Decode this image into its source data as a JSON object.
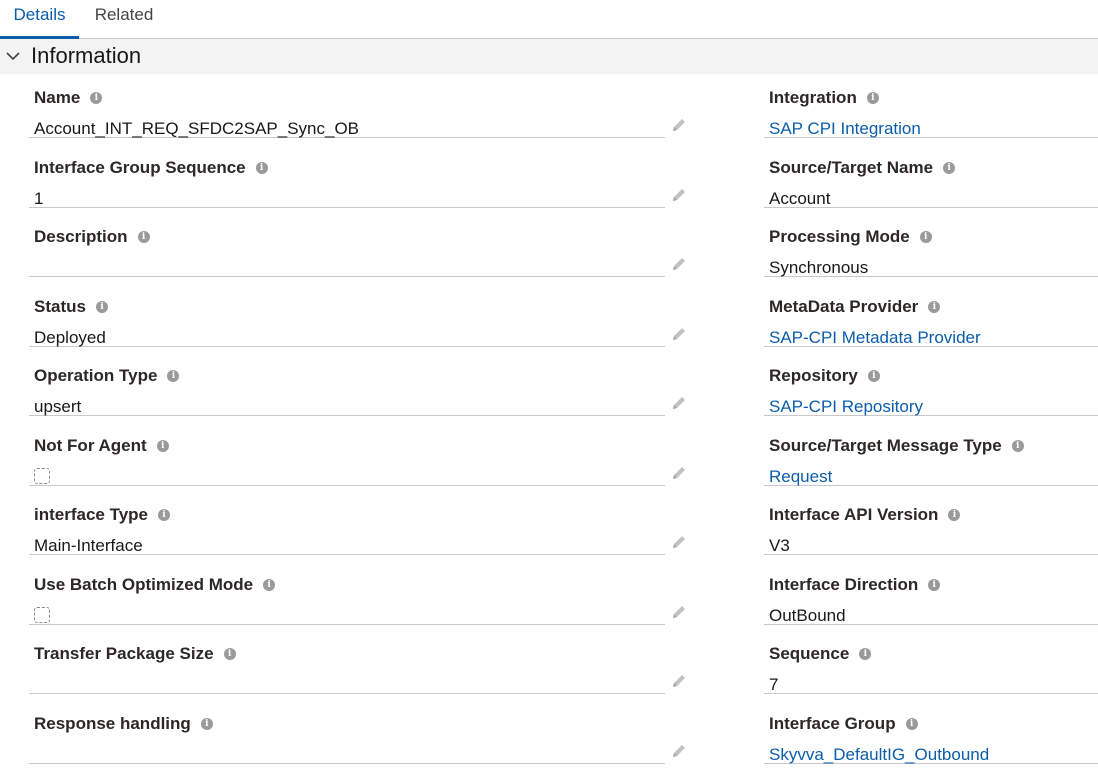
{
  "tabs": [
    {
      "label": "Details",
      "active": true
    },
    {
      "label": "Related",
      "active": false
    }
  ],
  "section": {
    "title": "Information",
    "icon": "chevron-down-icon"
  },
  "left_fields": [
    {
      "label": "Name",
      "value": "Account_INT_REQ_SFDC2SAP_Sync_OB",
      "type": "text"
    },
    {
      "label": "Interface Group Sequence",
      "value": "1",
      "type": "text"
    },
    {
      "label": "Description",
      "value": "",
      "type": "text"
    },
    {
      "label": "Status",
      "value": "Deployed",
      "type": "text"
    },
    {
      "label": "Operation Type",
      "value": "upsert",
      "type": "text"
    },
    {
      "label": "Not For Agent",
      "value": "",
      "type": "checkbox",
      "checked": false
    },
    {
      "label": "interface Type",
      "value": "Main-Interface",
      "type": "text"
    },
    {
      "label": "Use Batch Optimized Mode",
      "value": "",
      "type": "checkbox",
      "checked": false
    },
    {
      "label": "Transfer Package Size",
      "value": "",
      "type": "text"
    },
    {
      "label": "Response handling",
      "value": "",
      "type": "text"
    }
  ],
  "right_fields": [
    {
      "label": "Integration",
      "value": "SAP CPI Integration",
      "type": "link"
    },
    {
      "label": "Source/Target Name",
      "value": "Account",
      "type": "text"
    },
    {
      "label": "Processing Mode",
      "value": "Synchronous",
      "type": "text"
    },
    {
      "label": "MetaData Provider",
      "value": "SAP-CPI Metadata Provider",
      "type": "link"
    },
    {
      "label": "Repository",
      "value": "SAP-CPI Repository",
      "type": "link"
    },
    {
      "label": "Source/Target Message Type",
      "value": "Request",
      "type": "link"
    },
    {
      "label": "Interface API Version",
      "value": "V3",
      "type": "text"
    },
    {
      "label": "Interface Direction",
      "value": "OutBound",
      "type": "text"
    },
    {
      "label": "Sequence",
      "value": "7",
      "type": "text"
    },
    {
      "label": "Interface Group",
      "value": "Skyvva_DefaultIG_Outbound",
      "type": "link"
    }
  ],
  "colors": {
    "link": "#0b5cab",
    "active_tab": "#0b5cab",
    "section_bg": "#f3f3f3",
    "divider": "#c9c9c9"
  }
}
